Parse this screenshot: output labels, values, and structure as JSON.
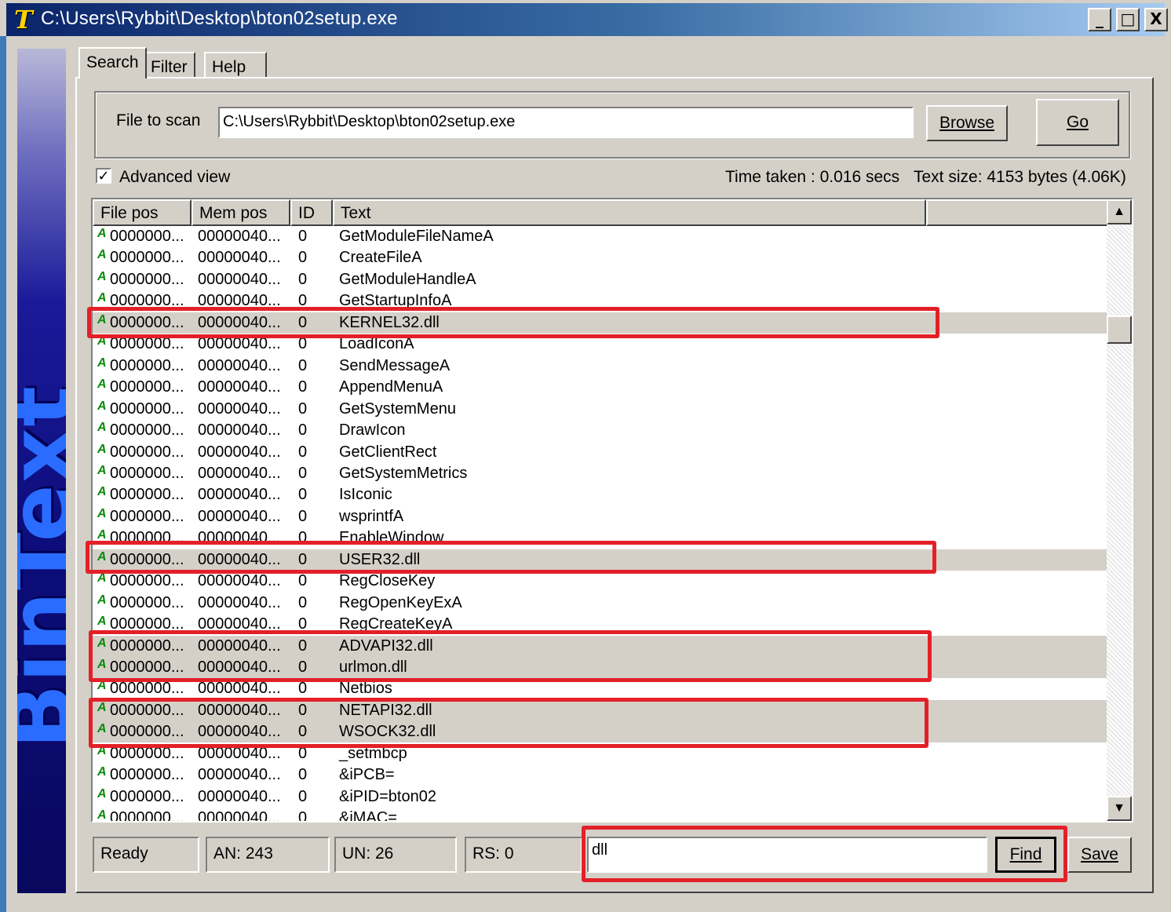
{
  "window": {
    "title": "C:\\Users\\Rybbit\\Desktop\\bton02setup.exe",
    "app_icon_letter": "T",
    "minimize_glyph": "_",
    "maximize_glyph": "□",
    "close_glyph": "X"
  },
  "banner": {
    "text": "BinText"
  },
  "tabs": [
    {
      "label": "Search"
    },
    {
      "label": "Filter"
    },
    {
      "label": "Help"
    }
  ],
  "search": {
    "file_label": "File to scan",
    "file_value": "C:\\Users\\Rybbit\\Desktop\\bton02setup.exe",
    "browse_label": "Browse",
    "go_label": "Go",
    "advanced_view_label": "Advanced view",
    "advanced_view_checked": true,
    "time_taken": "Time taken : 0.016 secs",
    "text_size": "Text size: 4153 bytes (4.06K)"
  },
  "table": {
    "columns": [
      "File pos",
      "Mem pos",
      "ID",
      "Text"
    ],
    "rows": [
      {
        "file": "0000000...",
        "mem": "00000040...",
        "id": "0",
        "text": "GetModuleFileNameA"
      },
      {
        "file": "0000000...",
        "mem": "00000040...",
        "id": "0",
        "text": "CreateFileA"
      },
      {
        "file": "0000000...",
        "mem": "00000040...",
        "id": "0",
        "text": "GetModuleHandleA"
      },
      {
        "file": "0000000...",
        "mem": "00000040...",
        "id": "0",
        "text": "GetStartupInfoA"
      },
      {
        "file": "0000000...",
        "mem": "00000040...",
        "id": "0",
        "text": "KERNEL32.dll",
        "selected": true
      },
      {
        "file": "0000000...",
        "mem": "00000040...",
        "id": "0",
        "text": "LoadIconA"
      },
      {
        "file": "0000000...",
        "mem": "00000040...",
        "id": "0",
        "text": "SendMessageA"
      },
      {
        "file": "0000000...",
        "mem": "00000040...",
        "id": "0",
        "text": "AppendMenuA"
      },
      {
        "file": "0000000...",
        "mem": "00000040...",
        "id": "0",
        "text": "GetSystemMenu"
      },
      {
        "file": "0000000...",
        "mem": "00000040...",
        "id": "0",
        "text": "DrawIcon"
      },
      {
        "file": "0000000...",
        "mem": "00000040...",
        "id": "0",
        "text": "GetClientRect"
      },
      {
        "file": "0000000...",
        "mem": "00000040...",
        "id": "0",
        "text": "GetSystemMetrics"
      },
      {
        "file": "0000000...",
        "mem": "00000040...",
        "id": "0",
        "text": "IsIconic"
      },
      {
        "file": "0000000...",
        "mem": "00000040...",
        "id": "0",
        "text": "wsprintfA"
      },
      {
        "file": "0000000...",
        "mem": "00000040...",
        "id": "0",
        "text": "EnableWindow"
      },
      {
        "file": "0000000...",
        "mem": "00000040...",
        "id": "0",
        "text": "USER32.dll",
        "selected": true
      },
      {
        "file": "0000000...",
        "mem": "00000040...",
        "id": "0",
        "text": "RegCloseKey"
      },
      {
        "file": "0000000...",
        "mem": "00000040...",
        "id": "0",
        "text": "RegOpenKeyExA"
      },
      {
        "file": "0000000...",
        "mem": "00000040...",
        "id": "0",
        "text": "RegCreateKeyA"
      },
      {
        "file": "0000000...",
        "mem": "00000040...",
        "id": "0",
        "text": "ADVAPI32.dll",
        "selected": true
      },
      {
        "file": "0000000...",
        "mem": "00000040...",
        "id": "0",
        "text": "urlmon.dll",
        "selected": true
      },
      {
        "file": "0000000...",
        "mem": "00000040...",
        "id": "0",
        "text": "Netbios"
      },
      {
        "file": "0000000...",
        "mem": "00000040...",
        "id": "0",
        "text": "NETAPI32.dll",
        "selected": true
      },
      {
        "file": "0000000...",
        "mem": "00000040...",
        "id": "0",
        "text": "WSOCK32.dll",
        "selected": true
      },
      {
        "file": "0000000...",
        "mem": "00000040...",
        "id": "0",
        "text": "_setmbcp"
      },
      {
        "file": "0000000...",
        "mem": "00000040...",
        "id": "0",
        "text": "&iPCB="
      },
      {
        "file": "0000000...",
        "mem": "00000040...",
        "id": "0",
        "text": "&iPID=bton02"
      },
      {
        "file": "0000000...",
        "mem": "00000040...",
        "id": "0",
        "text": "&iMAC="
      }
    ],
    "row_icon_glyph": "A",
    "scroll_up_glyph": "▲",
    "scroll_down_glyph": "▼"
  },
  "status": {
    "state": "Ready",
    "an": "AN: 243",
    "un": "UN: 26",
    "rs": "RS: 0"
  },
  "find": {
    "value": "dll",
    "find_label": "Find",
    "save_label": "Save"
  },
  "colors": {
    "highlight_box": "#e32028",
    "title_gradient_start": "#0a246a",
    "banner_text": "#2a6cff",
    "ansi_icon": "#0a8a0a"
  }
}
